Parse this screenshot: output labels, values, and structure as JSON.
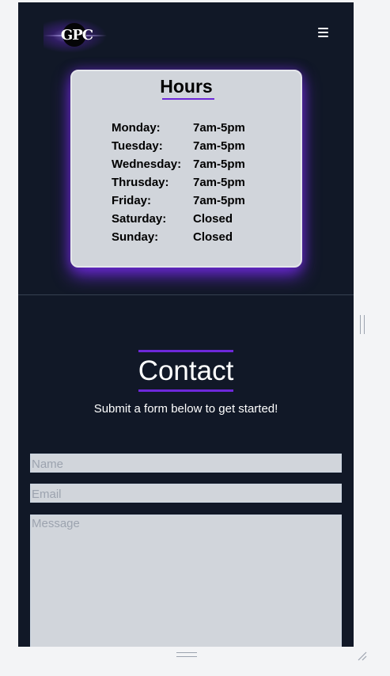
{
  "header": {
    "logo_text": "GPC",
    "menu_icon": "hamburger-menu-icon"
  },
  "hours": {
    "title": "Hours",
    "rows": [
      {
        "day": "Monday:",
        "time": "7am-5pm"
      },
      {
        "day": "Tuesday:",
        "time": "7am-5pm"
      },
      {
        "day": "Wednesday:",
        "time": "7am-5pm"
      },
      {
        "day": "Thrusday:",
        "time": "7am-5pm"
      },
      {
        "day": "Friday:",
        "time": "7am-5pm"
      },
      {
        "day": "Saturday:",
        "time": "Closed"
      },
      {
        "day": "Sunday:",
        "time": "Closed"
      }
    ]
  },
  "contact": {
    "title": "Contact",
    "subtitle": "Submit a form below to get started!",
    "name_placeholder": "Name",
    "email_placeholder": "Email",
    "message_placeholder": "Message"
  },
  "colors": {
    "background": "#111827",
    "accent": "#6d28d9",
    "card": "#d1d5db",
    "text_light": "#ffffff"
  }
}
